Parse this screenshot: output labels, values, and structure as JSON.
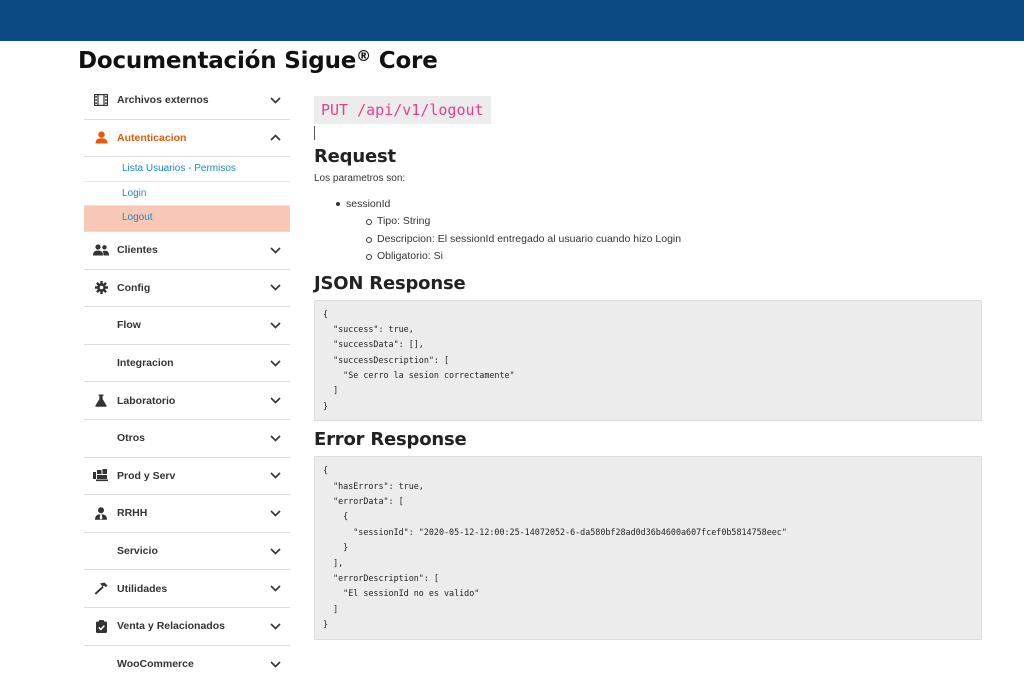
{
  "page": {
    "title_main": "Documentación Sigue",
    "title_mark": "®",
    "title_tail": " Core"
  },
  "sidebar": {
    "items": [
      {
        "label": "Archivos externos",
        "icon": "film-icon",
        "expanded": false
      },
      {
        "label": "Autenticacion",
        "icon": "user-icon",
        "expanded": true,
        "active": true,
        "children": [
          {
            "label": "Lista Usuarios - Permisos"
          },
          {
            "label": "Login"
          },
          {
            "label": "Logout",
            "selected": true
          }
        ]
      },
      {
        "label": "Clientes",
        "icon": "users-icon",
        "expanded": false
      },
      {
        "label": "Config",
        "icon": "gear-icon",
        "expanded": false
      },
      {
        "label": "Flow",
        "icon": "",
        "expanded": false
      },
      {
        "label": "Integracion",
        "icon": "",
        "expanded": false
      },
      {
        "label": "Laboratorio",
        "icon": "flask-icon",
        "expanded": false
      },
      {
        "label": "Otros",
        "icon": "",
        "expanded": false
      },
      {
        "label": "Prod y Serv",
        "icon": "dolly-icon",
        "expanded": false
      },
      {
        "label": "RRHH",
        "icon": "user-tie-icon",
        "expanded": false
      },
      {
        "label": "Servicio",
        "icon": "",
        "expanded": false
      },
      {
        "label": "Utilidades",
        "icon": "hammer-icon",
        "expanded": false
      },
      {
        "label": "Venta y Relacionados",
        "icon": "clipboard-check-icon",
        "expanded": false
      },
      {
        "label": "WooCommerce",
        "icon": "",
        "expanded": false
      }
    ]
  },
  "main": {
    "endpoint": "PUT /api/v1/logout",
    "request_heading": "Request",
    "request_intro": "Los parametros son:",
    "param_name": "sessionId",
    "param_details": [
      "Tipo: String",
      "Descripcion: El sessionId entregado al usuario cuando hizo Login",
      "Obligatorio: Si"
    ],
    "json_heading": "JSON Response",
    "json_lines": [
      "{",
      "  \"success\": true,",
      "  \"successData\": [],",
      "  \"successDescription\": [",
      "    \"Se cerro la sesion correctamente\"",
      "  ]",
      "}"
    ],
    "error_heading": "Error Response",
    "error_lines": [
      "{",
      "  \"hasErrors\": true,",
      "  \"errorData\": [",
      "    {",
      "      \"sessionId\": \"2020-05-12-12:00:25-14072052-6-da580bf28ad0d36b4600a607fcef0b5814758eec\"",
      "    }",
      "  ],",
      "  \"errorDescription\": [",
      "    \"El sessionId no es valido\"",
      "  ]",
      "}"
    ]
  },
  "colors": {
    "topbar": "#0b4a82",
    "active_orange": "#e8590c",
    "link_blue": "#1a8cc8",
    "selected_bg": "#f9c7b5",
    "code_pink": "#e83e8c"
  }
}
